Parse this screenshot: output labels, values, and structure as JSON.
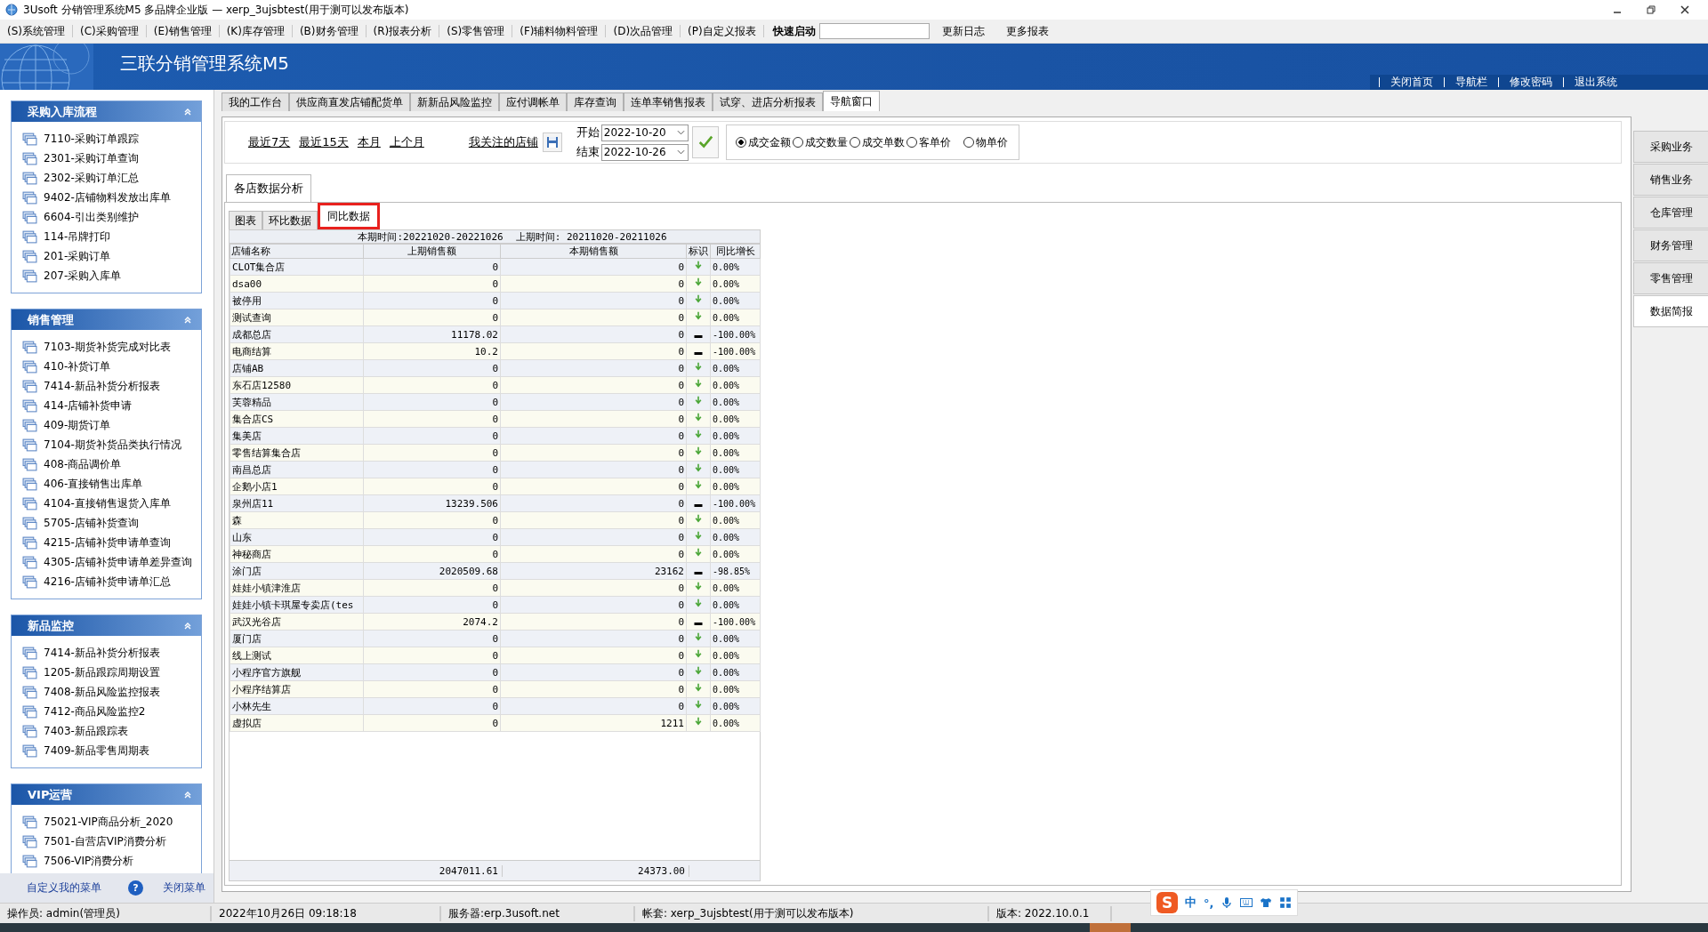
{
  "window": {
    "title": "3Usoft 分销管理系统M5 多品牌企业版 — xerp_3ujsbtest(用于测可以发布版本)"
  },
  "menu": [
    "(S)系统管理",
    "(C)采购管理",
    "(E)销售管理",
    "(K)库存管理",
    "(B)财务管理",
    "(R)报表分析",
    "(S)零售管理",
    "(F)辅料物料管理",
    "(D)次品管理",
    "(P)自定义报表"
  ],
  "quick_launch": {
    "label": "快速启动"
  },
  "menu_links": [
    "更新日志",
    "更多报表"
  ],
  "banner": {
    "title": "三联分销管理系统M5",
    "links": [
      "关闭首页",
      "导航栏",
      "修改密码",
      "退出系统"
    ]
  },
  "sidebar": {
    "panels": [
      {
        "title": "采购入库流程",
        "items": [
          "7110-采购订单跟踪",
          "2301-采购订单查询",
          "2302-采购订单汇总",
          "9402-店铺物料发放出库单",
          "6604-引出类别维护",
          "114-吊牌打印",
          "201-采购订单",
          "207-采购入库单"
        ]
      },
      {
        "title": "销售管理",
        "items": [
          "7103-期货补货完成对比表",
          "410-补货订单",
          "7414-新品补货分析报表",
          "414-店铺补货申请",
          "409-期货订单",
          "7104-期货补货品类执行情况",
          "408-商品调价单",
          "406-直接销售出库单",
          "4104-直接销售退货入库单",
          "5705-店铺补货查询",
          "4215-店铺补货申请单查询",
          "4305-店铺补货申请单差异查询",
          "4216-店铺补货申请单汇总"
        ]
      },
      {
        "title": "新品监控",
        "items": [
          "7414-新品补货分析报表",
          "1205-新品跟踪周期设置",
          "7408-新品风险监控报表",
          "7412-商品风险监控2",
          "7403-新品跟踪表",
          "7409-新品零售周期表"
        ]
      },
      {
        "title": "VIP运营",
        "items": [
          "75021-VIP商品分析_2020",
          "7501-自营店VIP消费分析",
          "7506-VIP消费分析"
        ]
      }
    ],
    "footer": {
      "custom_menu": "自定义我的菜单",
      "help": "?",
      "close_menu": "关闭菜单"
    }
  },
  "tabs": [
    {
      "label": "我的工作台",
      "selected": false
    },
    {
      "label": "供应商直发店铺配货单",
      "selected": false
    },
    {
      "label": "新新品风险监控",
      "selected": false
    },
    {
      "label": "应付调帐单",
      "selected": false
    },
    {
      "label": "库存查询",
      "selected": false
    },
    {
      "label": "连单率销售报表",
      "selected": false
    },
    {
      "label": "试穿、进店分析报表",
      "selected": false
    },
    {
      "label": "导航窗口",
      "selected": true
    }
  ],
  "toolbar": {
    "quick_ranges": [
      "最近7天",
      "最近15天",
      "本月",
      "上个月"
    ],
    "favorite_stores": "我关注的店铺",
    "start_label": "开始",
    "start": "2022-10-20",
    "end_label": "结束",
    "end": "2022-10-26",
    "metrics": [
      {
        "label": "成交金额",
        "selected": true
      },
      {
        "label": "成交数量",
        "selected": false
      },
      {
        "label": "成交单数",
        "selected": false
      },
      {
        "label": "客单价",
        "selected": false
      },
      {
        "label": "物单价",
        "selected": false
      }
    ]
  },
  "section_tab": {
    "label": "各店数据分析"
  },
  "subtabs": [
    {
      "label": "图表",
      "selected": false
    },
    {
      "label": "环比数据",
      "selected": false
    },
    {
      "label": "同比数据",
      "selected": true
    }
  ],
  "table": {
    "period": "本期时间:20221020-20221026",
    "prev_period": "上期时间: 20211020-20211026",
    "columns": [
      "店铺名称",
      "上期销售额",
      "本期销售额",
      "标识",
      "同比增长"
    ],
    "rows": [
      {
        "name": "CLOT集合店",
        "prev": "0",
        "cur": "0",
        "kind": "down",
        "growth": "0.00%"
      },
      {
        "name": "dsa00",
        "prev": "0",
        "cur": "0",
        "kind": "down",
        "growth": "0.00%"
      },
      {
        "name": "被停用",
        "prev": "0",
        "cur": "0",
        "kind": "down",
        "growth": "0.00%"
      },
      {
        "name": "测试查询",
        "prev": "0",
        "cur": "0",
        "kind": "down",
        "growth": "0.00%"
      },
      {
        "name": "成都总店",
        "prev": "11178.02",
        "cur": "0",
        "kind": "dash",
        "growth": "-100.00%"
      },
      {
        "name": "电商结算",
        "prev": "10.2",
        "cur": "0",
        "kind": "dash",
        "growth": "-100.00%"
      },
      {
        "name": "店铺AB",
        "prev": "0",
        "cur": "0",
        "kind": "down",
        "growth": "0.00%"
      },
      {
        "name": "东石店12580",
        "prev": "0",
        "cur": "0",
        "kind": "down",
        "growth": "0.00%"
      },
      {
        "name": "芙蓉精品",
        "prev": "0",
        "cur": "0",
        "kind": "down",
        "growth": "0.00%"
      },
      {
        "name": "集合店CS",
        "prev": "0",
        "cur": "0",
        "kind": "down",
        "growth": "0.00%"
      },
      {
        "name": "集美店",
        "prev": "0",
        "cur": "0",
        "kind": "down",
        "growth": "0.00%"
      },
      {
        "name": "零售结算集合店",
        "prev": "0",
        "cur": "0",
        "kind": "down",
        "growth": "0.00%"
      },
      {
        "name": "南昌总店",
        "prev": "0",
        "cur": "0",
        "kind": "down",
        "growth": "0.00%"
      },
      {
        "name": "企鹅小店1",
        "prev": "0",
        "cur": "0",
        "kind": "down",
        "growth": "0.00%"
      },
      {
        "name": "泉州店11",
        "prev": "13239.506",
        "cur": "0",
        "kind": "dash",
        "growth": "-100.00%"
      },
      {
        "name": "森",
        "prev": "0",
        "cur": "0",
        "kind": "down",
        "growth": "0.00%"
      },
      {
        "name": "山东",
        "prev": "0",
        "cur": "0",
        "kind": "down",
        "growth": "0.00%"
      },
      {
        "name": "神秘商店",
        "prev": "0",
        "cur": "0",
        "kind": "down",
        "growth": "0.00%"
      },
      {
        "name": "涂门店",
        "prev": "2020509.68",
        "cur": "23162",
        "kind": "dash",
        "growth": "-98.85%"
      },
      {
        "name": "娃娃小镇津淮店",
        "prev": "0",
        "cur": "0",
        "kind": "down",
        "growth": "0.00%"
      },
      {
        "name": "娃娃小镇卡琪屋专卖店(tes",
        "prev": "0",
        "cur": "0",
        "kind": "down",
        "growth": "0.00%"
      },
      {
        "name": "武汉光谷店",
        "prev": "2074.2",
        "cur": "0",
        "kind": "dash",
        "growth": "-100.00%"
      },
      {
        "name": "厦门店",
        "prev": "0",
        "cur": "0",
        "kind": "down",
        "growth": "0.00%"
      },
      {
        "name": "线上测试",
        "prev": "0",
        "cur": "0",
        "kind": "down",
        "growth": "0.00%"
      },
      {
        "name": "小程序官方旗舰",
        "prev": "0",
        "cur": "0",
        "kind": "down",
        "growth": "0.00%"
      },
      {
        "name": "小程序结算店",
        "prev": "0",
        "cur": "0",
        "kind": "down",
        "growth": "0.00%"
      },
      {
        "name": "小林先生",
        "prev": "0",
        "cur": "0",
        "kind": "down",
        "growth": "0.00%"
      },
      {
        "name": "虚拟店",
        "prev": "0",
        "cur": "1211",
        "kind": "down",
        "growth": "0.00%"
      }
    ],
    "totals": {
      "prev": "2047011.61",
      "cur": "24373.00"
    }
  },
  "right_nav": [
    {
      "label": "采购业务",
      "selected": false
    },
    {
      "label": "销售业务",
      "selected": false
    },
    {
      "label": "仓库管理",
      "selected": false
    },
    {
      "label": "财务管理",
      "selected": false
    },
    {
      "label": "零售管理",
      "selected": false
    },
    {
      "label": "数据简报",
      "selected": true
    }
  ],
  "status_bar": [
    "操作员: admin(管理员)",
    "2022年10月26日 09:18:18",
    "服务器:erp.3usoft.net",
    "帐套: xerp_3ujsbtest(用于测可以发布版本)",
    "版本: 2022.10.0.1"
  ],
  "ime": {
    "logo": "S",
    "mode": "中",
    "punct": "°,"
  }
}
